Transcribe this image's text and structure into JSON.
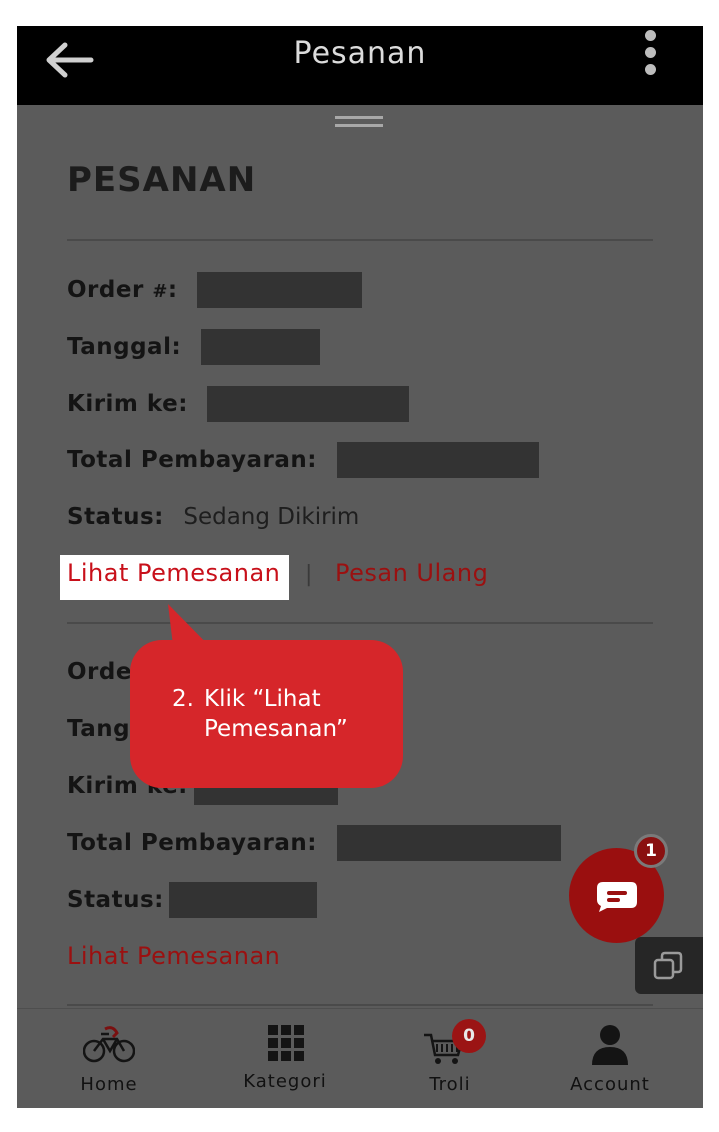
{
  "header": {
    "title": "Pesanan"
  },
  "page": {
    "heading": "PESANAN"
  },
  "orders": [
    {
      "order_label": "Order",
      "order_hash": "#",
      "date_label": "Tanggal",
      "ship_label": "Kirim ke",
      "total_label": "Total Pembayaran",
      "status_label": "Status",
      "status_value": "Sedang Dikirim",
      "view_link": "Lihat Pemesanan",
      "separator": "|",
      "reorder_link": "Pesan Ulang"
    },
    {
      "order_label": "Orde",
      "date_label": "Tang",
      "ship_label": "Kirim ke:",
      "total_label": "Total Pembayaran",
      "status_label": "Status",
      "view_link": "Lihat Pemesanan"
    }
  ],
  "tooltip": {
    "step": "2.",
    "text_line1": "Klik “Lihat",
    "text_line2": "Pemesanan”"
  },
  "chat": {
    "badge_count": "1"
  },
  "bottom_nav": {
    "items": [
      {
        "label": "Home",
        "icon": "bicycle-icon"
      },
      {
        "label": "Kategori",
        "icon": "grid-icon"
      },
      {
        "label": "Troli",
        "icon": "cart-icon",
        "badge": "0"
      },
      {
        "label": "Account",
        "icon": "user-icon"
      }
    ]
  },
  "colors": {
    "overlay": "#5b5b5b",
    "link_red": "#9b1010",
    "tooltip_red": "#d6262a",
    "appbar": "#000000"
  }
}
